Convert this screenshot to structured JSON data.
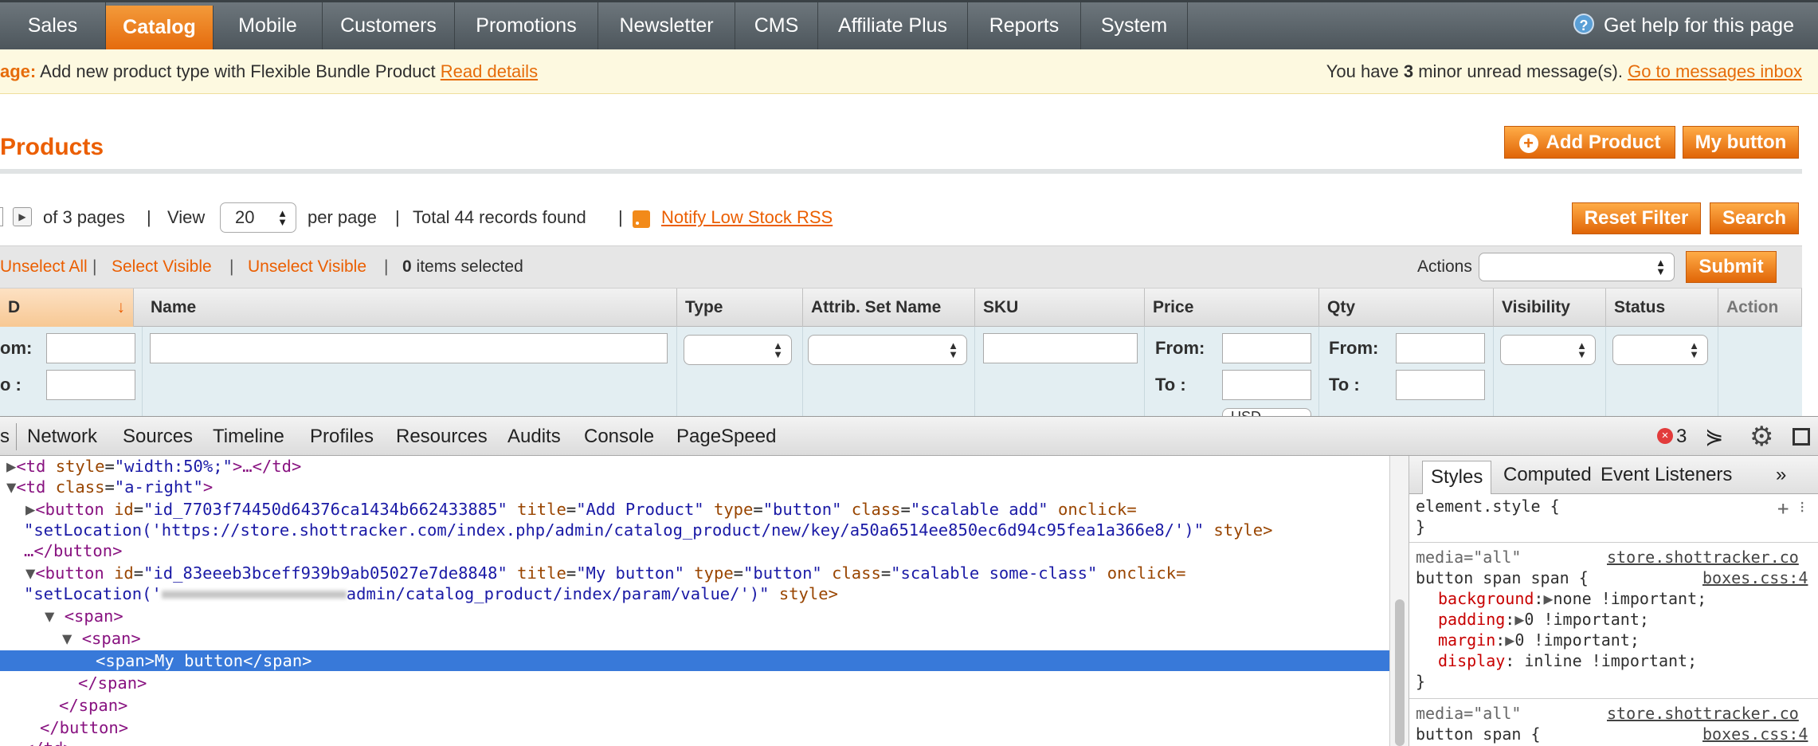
{
  "nav": {
    "items": [
      "Sales",
      "Catalog",
      "Mobile",
      "Customers",
      "Promotions",
      "Newsletter",
      "CMS",
      "Affiliate Plus",
      "Reports",
      "System"
    ],
    "active": "Catalog",
    "help": "Get help for this page"
  },
  "message": {
    "prefix": "age:",
    "text": " Add new product type with Flexible Bundle Product ",
    "link": "Read details",
    "right_prefix": "You have ",
    "right_count": "3",
    "right_suffix": " minor unread message(s). ",
    "right_link": "Go to messages inbox"
  },
  "page": {
    "title": "Products",
    "add_product": "Add Product",
    "my_button": "My button"
  },
  "pager": {
    "of_pages": "of 3 pages",
    "sep1": "|",
    "view": "View",
    "per_page_value": "20",
    "per_page": "per page",
    "sep2": "|",
    "total": "Total 44 records found",
    "sep3": "|",
    "rss": "Notify Low Stock RSS",
    "reset": "Reset Filter",
    "search": "Search"
  },
  "massaction": {
    "unselect_all": "Unselect All",
    "select_visible": "Select Visible",
    "unselect_visible": "Unselect Visible",
    "sep": "|",
    "count": "0",
    "count_suffix": " items selected",
    "actions_label": "Actions",
    "submit": "Submit"
  },
  "grid": {
    "columns": [
      "D",
      "Name",
      "Type",
      "Attrib. Set Name",
      "SKU",
      "Price",
      "Qty",
      "Visibility",
      "Status",
      "Action"
    ],
    "sort_arrow": "↓",
    "from": "From:",
    "to": "To :",
    "from_cut": "om:",
    "to_cut": "o :",
    "currency": "USD"
  },
  "devtools": {
    "tabs": [
      "s",
      "Network",
      "Sources",
      "Timeline",
      "Profiles",
      "Resources",
      "Audits",
      "Console",
      "PageSpeed"
    ],
    "errors": "3",
    "lines": [
      {
        "indent": "",
        "tri": "▶",
        "html": "td_width"
      },
      {
        "indent": "",
        "tri": "▼",
        "html": "td_aright"
      }
    ],
    "dom": {
      "l1_a": "<td ",
      "l1_attr": "style",
      "l1_val": "\"width:50%;\"",
      "l1_b": ">…</td>",
      "l2_a": "<td ",
      "l2_attr": "class",
      "l2_val": "\"a-right\"",
      "l2_b": ">",
      "l3_a": "<button ",
      "l3_id": "id",
      "l3_idv": "\"id_7703f74450d64376ca1434b662433885\"",
      "l3_title": "title",
      "l3_titlev": "\"Add Product\"",
      "l3_type": "type",
      "l3_typev": "\"button\"",
      "l3_class": "class",
      "l3_classv": "\"scalable add\"",
      "l3_onclick": "onclick=",
      "l4": "\"setLocation('https://store.shottracker.com/index.php/admin/catalog_product/new/key/a50a6514ee850ec6d94c95fea1a366e8/')\"",
      "l4_style": " style>",
      "l5": "…</button>",
      "l6_a": "<button ",
      "l6_id": "id",
      "l6_idv": "\"id_83eeeb3bceff939b9ab05027e7de8848\"",
      "l6_title": "title",
      "l6_titlev": "\"My button\"",
      "l6_type": "type",
      "l6_typev": "\"button\"",
      "l6_class": "class",
      "l6_classv": "\"scalable some-class\"",
      "l6_onclick": "onclick=",
      "l7_a": "\"setLocation('",
      "l7_b": "admin/catalog_product/index/param/value/')\"",
      "l7_style": " style>",
      "l8": "<span>",
      "l9": "<span>",
      "l10": "<span>My button</span>",
      "l11": "</span>",
      "l12": "</span>",
      "l13": "</button>",
      "l14": "</td>"
    }
  },
  "sidebar": {
    "tabs": [
      "Styles",
      "Computed",
      "Event Listeners",
      "»"
    ],
    "element_style": "element.style {",
    "close": "}",
    "media1": "media=\"all\"",
    "src1": "store.shottracker.co",
    "sel1": "button span span {",
    "file1": "boxes.css:4",
    "rules": [
      {
        "prop": "background",
        "val": "none !important;"
      },
      {
        "prop": "padding",
        "val": "0 !important;"
      },
      {
        "prop": "margin",
        "val": "0 !important;"
      },
      {
        "prop": "display",
        "val": "inline !important;"
      }
    ],
    "media2": "media=\"all\"",
    "src2": "store.shottracker.co",
    "sel2": "button span {",
    "file2": "boxes.css:4"
  },
  "colors": {
    "accent": "#eb5e00",
    "selection": "#3879d9"
  }
}
